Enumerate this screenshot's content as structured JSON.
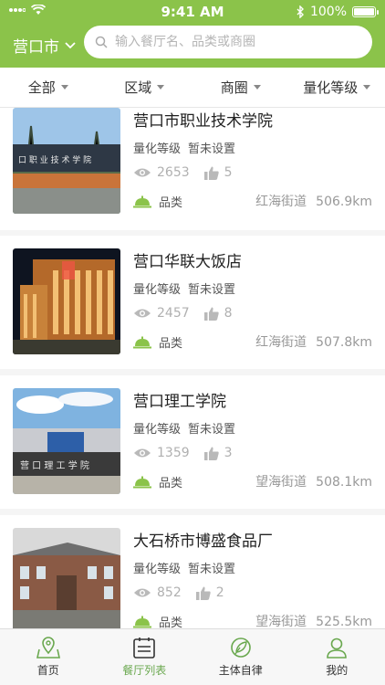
{
  "status": {
    "time": "9:41 AM",
    "battery": "100%"
  },
  "city": "营口市",
  "search": {
    "placeholder": "输入餐厅名、品类或商圈"
  },
  "filters": [
    "全部",
    "区域",
    "商圈",
    "量化等级"
  ],
  "restaurants": [
    {
      "name": "营口市职业技术学院",
      "quant_label": "量化等级",
      "quant_value": "暂未设置",
      "views": "2653",
      "likes": "5",
      "category": "品类",
      "street": "红海街道",
      "distance": "506.9km"
    },
    {
      "name": "营口华联大饭店",
      "quant_label": "量化等级",
      "quant_value": "暂未设置",
      "views": "2457",
      "likes": "8",
      "category": "品类",
      "street": "红海街道",
      "distance": "507.8km"
    },
    {
      "name": "营口理工学院",
      "quant_label": "量化等级",
      "quant_value": "暂未设置",
      "views": "1359",
      "likes": "3",
      "category": "品类",
      "street": "望海街道",
      "distance": "508.1km"
    },
    {
      "name": "大石桥市博盛食品厂",
      "quant_label": "量化等级",
      "quant_value": "暂未设置",
      "views": "852",
      "likes": "2",
      "category": "品类",
      "street": "望海街道",
      "distance": "525.5km"
    }
  ],
  "tabs": [
    {
      "label": "首页",
      "icon": "map-pin-icon"
    },
    {
      "label": "餐厅列表",
      "icon": "list-icon",
      "active": true
    },
    {
      "label": "主体自律",
      "icon": "leaf-icon"
    },
    {
      "label": "我的",
      "icon": "user-icon"
    }
  ],
  "colors": {
    "brand": "#8bc34a",
    "active_tab": "#6aa84f"
  }
}
